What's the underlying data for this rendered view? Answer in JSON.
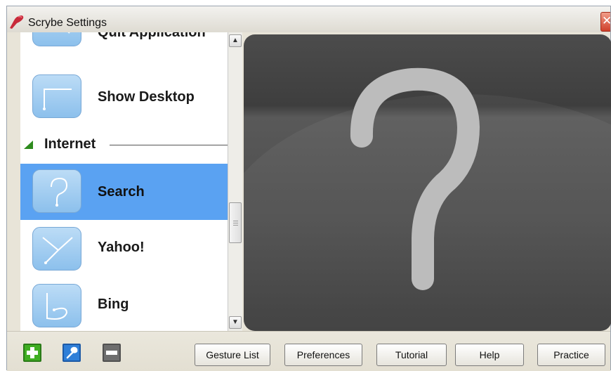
{
  "window": {
    "title": "Scrybe Settings"
  },
  "gestures": {
    "partial_item_label": "Quit Application",
    "items": [
      {
        "label": "Show Desktop"
      },
      {
        "label": "Search"
      },
      {
        "label": "Yahoo!"
      },
      {
        "label": "Bing"
      }
    ],
    "section": {
      "title": "Internet",
      "expanded": true
    },
    "selected": "Search"
  },
  "scrollbar": {
    "up_glyph": "▲",
    "down_glyph": "▼"
  },
  "preview": {
    "gesture_name": "Search",
    "background_color": "#4a4a4a",
    "stroke_color": "#bcbcbc"
  },
  "toolbar": {
    "add_icon": "plus-icon",
    "edit_icon": "wrench-icon",
    "remove_icon": "minus-icon",
    "buttons": [
      {
        "label": "Gesture List"
      },
      {
        "label": "Preferences"
      },
      {
        "label": "Tutorial"
      },
      {
        "label": "Help"
      },
      {
        "label": "Practice"
      }
    ]
  },
  "colors": {
    "selection": "#5aa2f2",
    "section_triangle": "#2e8b1e",
    "close_button": "#d0402a"
  }
}
